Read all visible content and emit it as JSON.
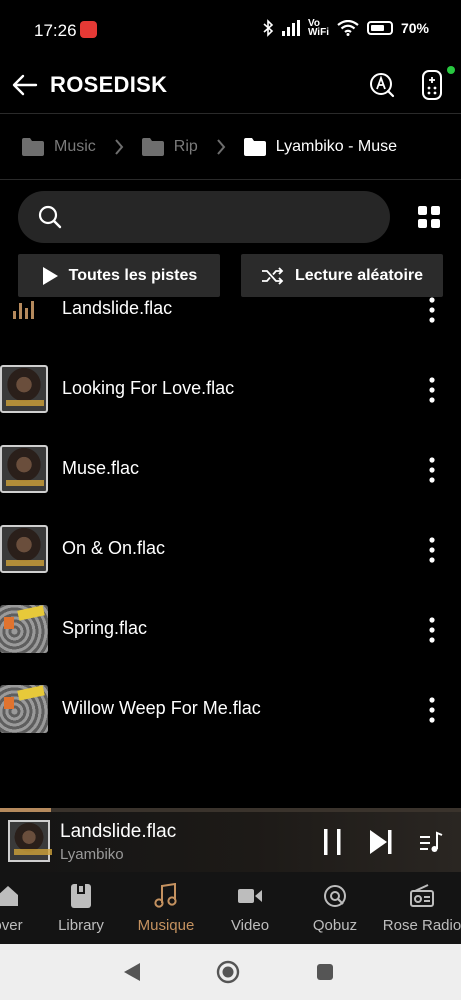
{
  "status_bar": {
    "time": "17:26",
    "vowifi": "Vo\nWiFi",
    "battery": "70%",
    "icons": [
      "bluetooth-icon",
      "signal-icon",
      "vowifi-icon",
      "wifi-icon",
      "battery-icon"
    ]
  },
  "app_bar": {
    "title": "ROSEDISK",
    "icons": [
      "back-arrow-icon",
      "a-circle-icon",
      "remote-icon"
    ],
    "accent_dot_color": "#28c840"
  },
  "breadcrumb": {
    "items": [
      {
        "label": "Music",
        "active": false
      },
      {
        "label": "Rip",
        "active": false
      },
      {
        "label": "Lyambiko - Muse",
        "active": true
      }
    ]
  },
  "search": {
    "placeholder": "",
    "value": ""
  },
  "actions": {
    "play_all": "Toutes les pistes",
    "shuffle": "Lecture aléatoire"
  },
  "tracks": [
    {
      "name": "Landslide.flac",
      "art": "playing-eq",
      "playing": true
    },
    {
      "name": "Looking For Love.flac",
      "art": "muse-cover"
    },
    {
      "name": "Muse.flac",
      "art": "muse-cover"
    },
    {
      "name": "On & On.flac",
      "art": "muse-cover"
    },
    {
      "name": "Spring.flac",
      "art": "spring-cover"
    },
    {
      "name": "Willow Weep For Me.flac",
      "art": "spring-cover"
    }
  ],
  "mini_player": {
    "title": "Landslide.flac",
    "artist": "Lyambiko",
    "progress": 0.11,
    "accent_color": "#b58a5d"
  },
  "bottom_nav": {
    "items": [
      {
        "label": "over",
        "icon": "home-icon",
        "active": false
      },
      {
        "label": "Library",
        "icon": "library-icon",
        "active": false
      },
      {
        "label": "Musique",
        "icon": "music-note-icon",
        "active": true
      },
      {
        "label": "Video",
        "icon": "video-icon",
        "active": false
      },
      {
        "label": "Qobuz",
        "icon": "qobuz-icon",
        "active": false
      },
      {
        "label": "Rose Radio",
        "icon": "radio-icon",
        "active": false
      }
    ],
    "active_color": "#c59260"
  },
  "system_nav": {
    "buttons": [
      "back-triangle-icon",
      "home-circle-icon",
      "recents-square-icon"
    ]
  }
}
